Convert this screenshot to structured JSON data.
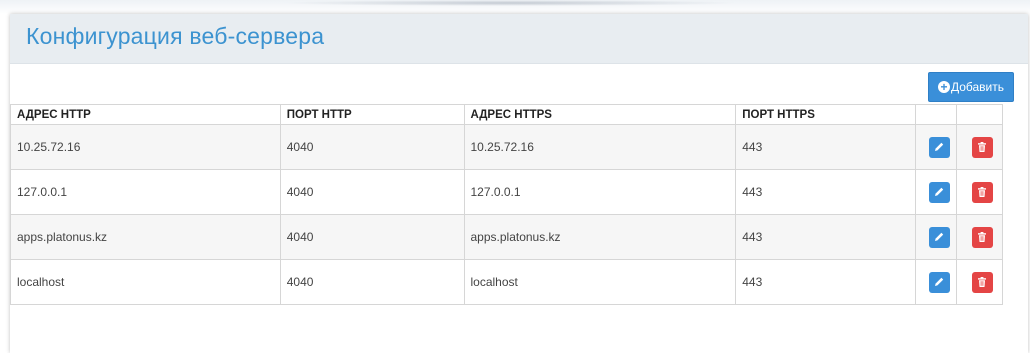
{
  "page": {
    "title": "Конфигурация веб-сервера",
    "add_button_label": "Добавить"
  },
  "table": {
    "columns": [
      "АДРЕС HTTP",
      "ПОРТ HTTP",
      "АДРЕС HTTPS",
      "ПОРТ HTTPS"
    ],
    "rows": [
      {
        "http_address": "10.25.72.16",
        "http_port": "4040",
        "https_address": "10.25.72.16",
        "https_port": "443"
      },
      {
        "http_address": "127.0.0.1",
        "http_port": "4040",
        "https_address": "127.0.0.1",
        "https_port": "443"
      },
      {
        "http_address": "apps.platonus.kz",
        "http_port": "4040",
        "https_address": "apps.platonus.kz",
        "https_port": "443"
      },
      {
        "http_address": "localhost",
        "http_port": "4040",
        "https_address": "localhost",
        "https_port": "443"
      }
    ]
  },
  "icons": {
    "add": "plus-circle-icon",
    "edit": "pencil-icon",
    "delete": "trash-icon"
  },
  "colors": {
    "title": "#3c93d0",
    "primary_button": "#3a8fd9",
    "danger_button": "#e44545",
    "header_bg": "#e8edf1"
  }
}
